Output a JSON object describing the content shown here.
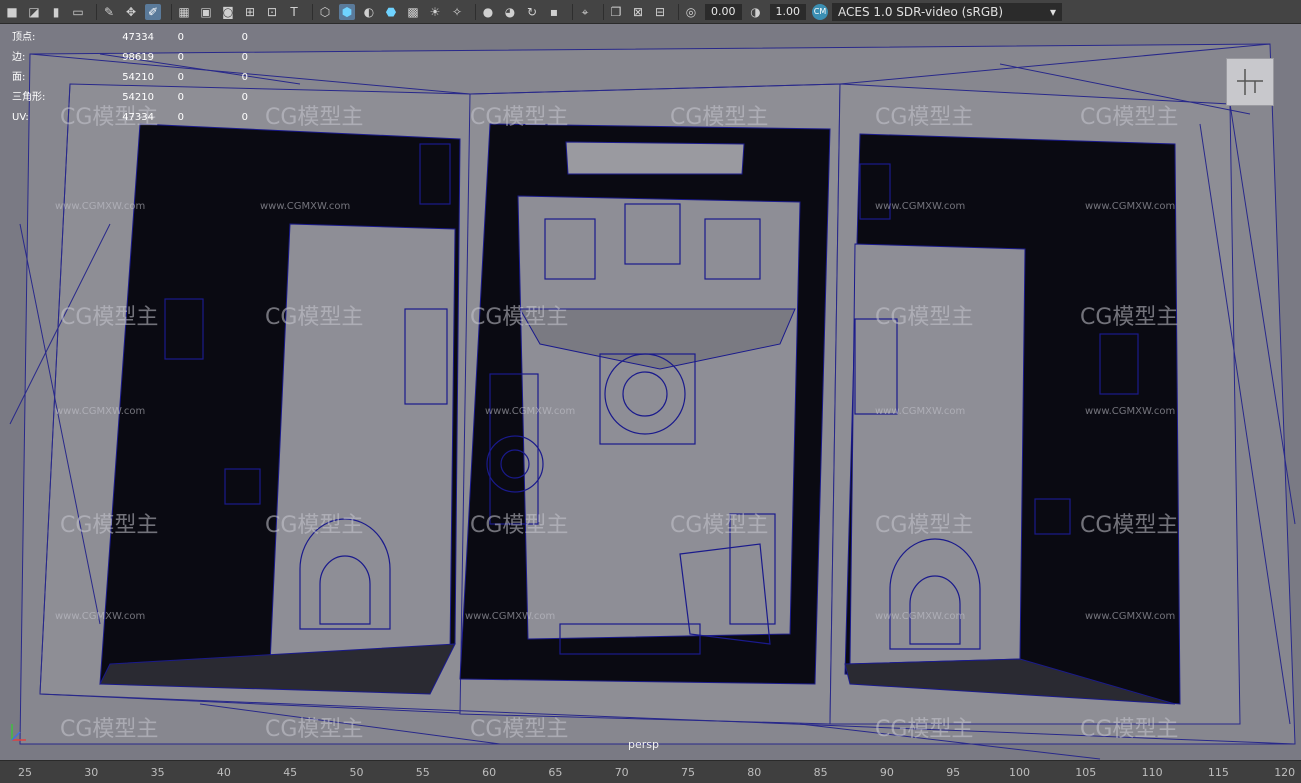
{
  "toolbar": {
    "exposure": "0.00",
    "gamma": "1.00",
    "colorspace_badge": "CM",
    "colorspace": "ACES 1.0 SDR-video (sRGB)"
  },
  "hud": {
    "rows": [
      {
        "label": "顶点:",
        "value": "47334",
        "a": "0",
        "b": "0"
      },
      {
        "label": "边:",
        "value": "98619",
        "a": "0",
        "b": "0"
      },
      {
        "label": "面:",
        "value": "54210",
        "a": "0",
        "b": "0"
      },
      {
        "label": "三角形:",
        "value": "54210",
        "a": "0",
        "b": "0"
      },
      {
        "label": "UV:",
        "value": "47334",
        "a": "0",
        "b": "0"
      }
    ]
  },
  "viewport": {
    "camera": "persp",
    "watermark": "CG模型主",
    "watermark_url": "www.CGMXW.com"
  },
  "timeline": {
    "ticks": [
      "25",
      "30",
      "35",
      "40",
      "45",
      "50",
      "55",
      "60",
      "65",
      "70",
      "75",
      "80",
      "85",
      "90",
      "95",
      "100",
      "105",
      "110",
      "115",
      "120"
    ]
  },
  "colors": {
    "toolbar_bg": "#444444",
    "viewport_bg": "#7a7a84",
    "wireframe": "#1a1a8c",
    "accent": "#5a7a9a"
  }
}
